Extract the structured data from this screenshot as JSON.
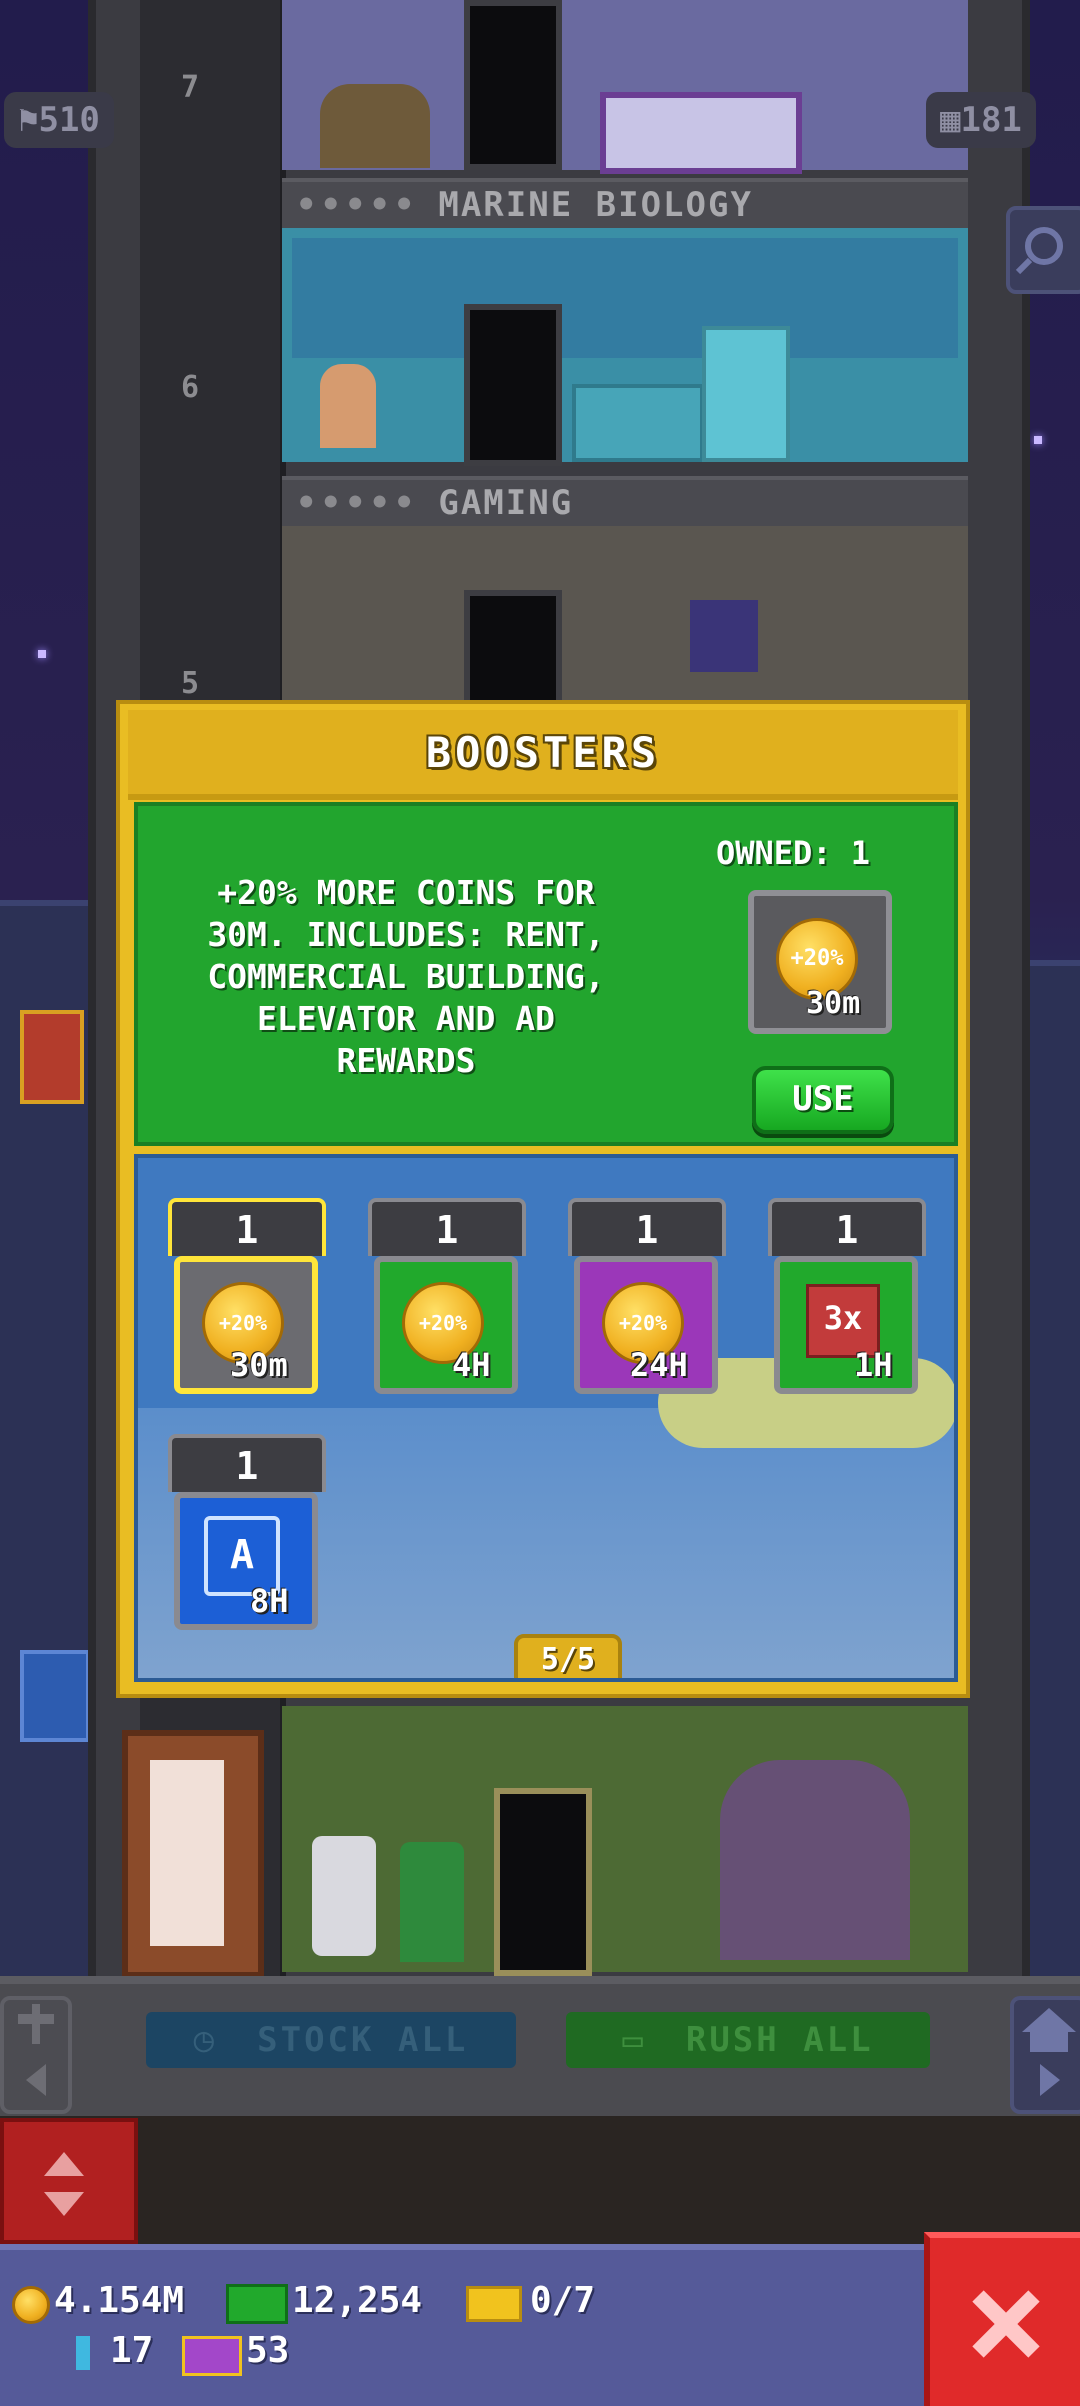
{
  "hud": {
    "population": "510",
    "floors_count": "181"
  },
  "floors": [
    {
      "number": "7"
    },
    {
      "number": "6",
      "label": "MARINE BIOLOGY",
      "stars": "•••••"
    },
    {
      "number": "5",
      "label": "GAMING",
      "stars": "•••••"
    }
  ],
  "boosters": {
    "title": "BOOSTERS",
    "description": "+20% MORE COINS FOR\n30M. INCLUDES: RENT,\nCOMMERCIAL BUILDING,\nELEVATOR AND AD\nREWARDS",
    "owned": "OWNED: 1",
    "selected_icon_text": "+20%",
    "selected_duration": "30m",
    "use_label": "USE",
    "items": [
      {
        "count": "1",
        "icon": "+20%",
        "duration": "30m",
        "color": "#6b6b70"
      },
      {
        "count": "1",
        "icon": "+20%",
        "duration": "4H",
        "color": "#21a92c"
      },
      {
        "count": "1",
        "icon": "+20%",
        "duration": "24H",
        "color": "#9b37b9"
      },
      {
        "count": "1",
        "icon": "3x",
        "duration": "1H",
        "color": "#21a92c"
      },
      {
        "count": "1",
        "icon": "A",
        "duration": "8H",
        "color": "#1c5fd6"
      }
    ],
    "pager": "5/5"
  },
  "actions": {
    "stock_all": "STOCK ALL",
    "rush_all": "RUSH ALL"
  },
  "status": {
    "coins": "4.154M",
    "bux": "12,254",
    "tickets": "0/7",
    "keys": "17",
    "gems": "53"
  },
  "colors": {
    "modal_gold": "#e9bd23",
    "detail_green": "#22a52e",
    "grid_blue": "#3f79c0",
    "close_red": "#e02a2a"
  }
}
